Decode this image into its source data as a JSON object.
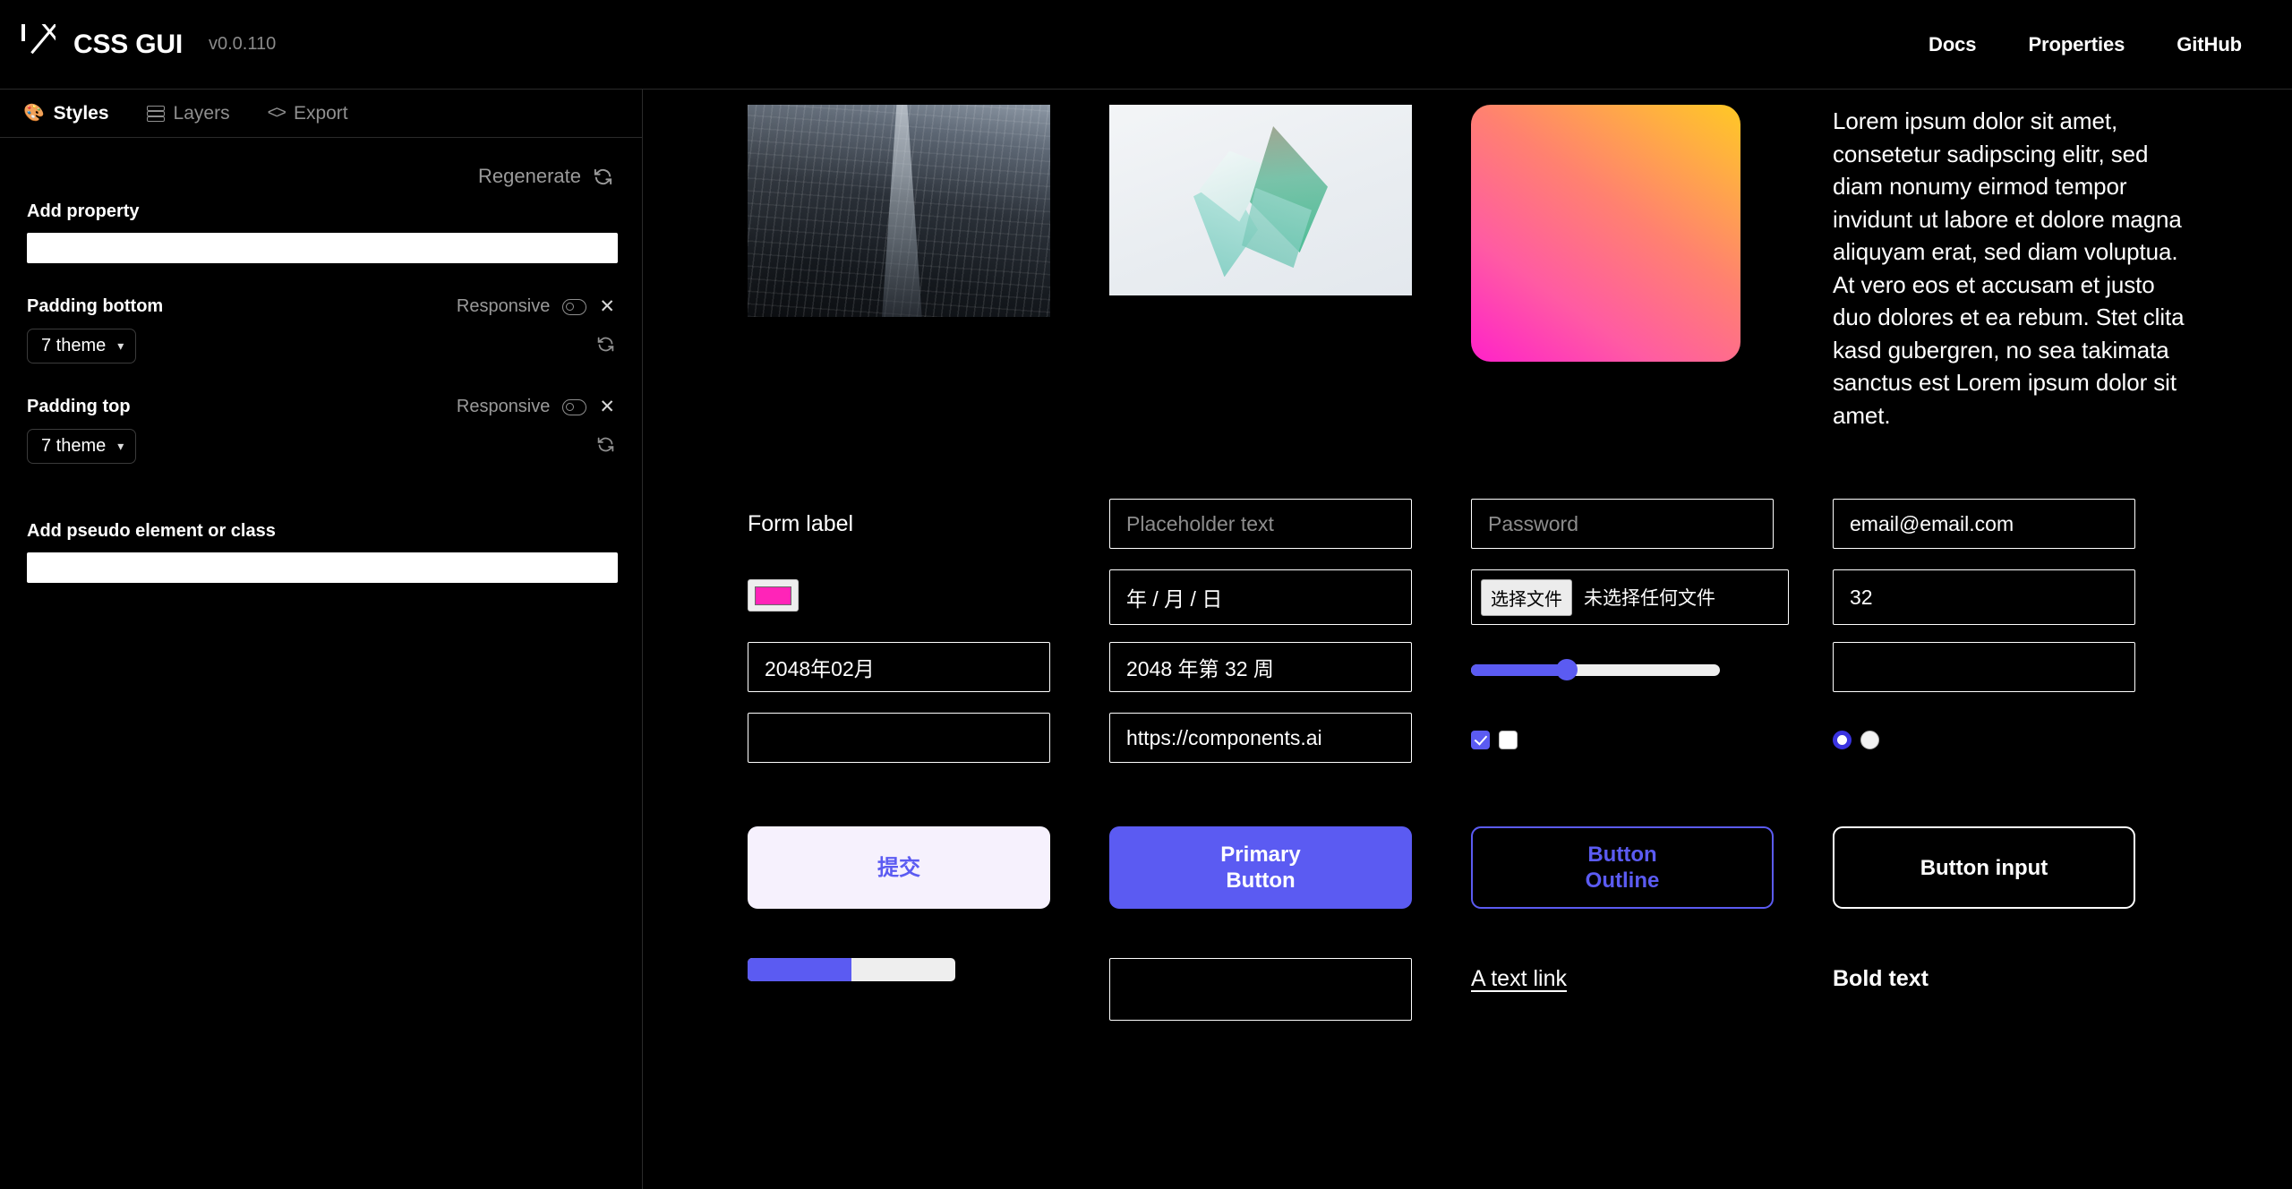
{
  "header": {
    "logo_icon": "crossed-box-icon",
    "brand": "CSS GUI",
    "version": "v0.0.110",
    "nav": [
      {
        "label": "Docs"
      },
      {
        "label": "Properties"
      },
      {
        "label": "GitHub"
      }
    ]
  },
  "sidebar": {
    "tabs": [
      {
        "label": "Styles",
        "icon": "palette-icon",
        "active": true
      },
      {
        "label": "Layers",
        "icon": "layers-icon",
        "active": false
      },
      {
        "label": "Export",
        "icon": "code-icon",
        "active": false
      }
    ],
    "regenerate": {
      "label": "Regenerate",
      "icon": "refresh-icon"
    },
    "add_property": {
      "label": "Add property",
      "value": "",
      "placeholder": ""
    },
    "properties": [
      {
        "name": "Padding bottom",
        "responsive_label": "Responsive",
        "responsive_on": false,
        "close_label": "✕",
        "value": "7 theme",
        "chevron": "⌄",
        "refresh_icon": "refresh-icon"
      },
      {
        "name": "Padding top",
        "responsive_label": "Responsive",
        "responsive_on": false,
        "close_label": "✕",
        "value": "7 theme",
        "chevron": "⌄",
        "refresh_icon": "refresh-icon"
      }
    ],
    "add_pseudo": {
      "label": "Add pseudo element or class",
      "value": "",
      "placeholder": ""
    }
  },
  "canvas": {
    "media": {
      "photo_building_alt": "building-photo",
      "photo_abstract_alt": "abstract-gem-photo",
      "gradient_card_alt": "gradient-card",
      "lorem": "Lorem ipsum dolor sit amet, consetetur sadipscing elitr, sed diam nonumy eirmod tempor invidunt ut labore et dolore magna aliquyam erat, sed diam voluptua. At vero eos et accusam et justo duo dolores et ea rebum. Stet clita kasd gubergren, no sea takimata sanctus est Lorem ipsum dolor sit amet."
    },
    "form": {
      "label": "Form label",
      "text_input": {
        "value": "",
        "placeholder": "Placeholder text"
      },
      "password_input": {
        "value": "",
        "placeholder": "Password"
      },
      "email_input": {
        "value": "email@email.com",
        "placeholder": ""
      },
      "color_input": {
        "value": "#ff24b8"
      },
      "date_input": {
        "value": "年 / 月 / 日"
      },
      "file_input": {
        "button": "选择文件",
        "status": "未选择任何文件"
      },
      "number_input": {
        "value": "32"
      },
      "month_input": {
        "value": "2048年02月"
      },
      "week_input": {
        "value": "2048 年第 32 周"
      },
      "range_input": {
        "value": 37,
        "min": 0,
        "max": 100
      },
      "time_input": {
        "value": ""
      },
      "blank_input": {
        "value": ""
      },
      "url_input": {
        "value": "https://components.ai"
      },
      "checkbox_checked": true,
      "checkbox_unchecked": false,
      "radio_checked": true,
      "radio_unchecked": false
    },
    "buttons": {
      "submit": "提交",
      "primary": "Primary\nButton",
      "primary_line1": "Primary",
      "primary_line2": "Button",
      "outline_line1": "Button",
      "outline_line2": "Outline",
      "button_input": "Button input"
    },
    "bottom": {
      "progress_value": 50,
      "textarea_value": "",
      "link_text": "A text link",
      "bold_text": "Bold text"
    }
  },
  "colors": {
    "background": "#000000",
    "primary": "#5b5bf2",
    "border": "#2a2a2a",
    "muted_text": "#8f8f8f",
    "gradient_from": "#ff22c9",
    "gradient_to": "#ffc825",
    "swatch": "#ff24b8"
  }
}
